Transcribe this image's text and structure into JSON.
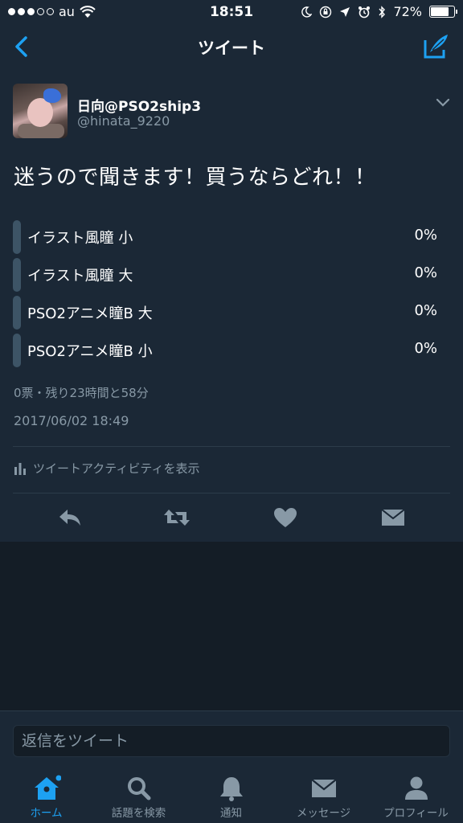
{
  "status_bar": {
    "carrier": "au",
    "time": "18:51",
    "battery": "72%"
  },
  "nav": {
    "title": "ツイート"
  },
  "tweet": {
    "display_name": "日向@PSO2ship3",
    "handle": "@hinata_9220",
    "text": "迷うので聞きます！買うならどれ！！",
    "poll": {
      "options": [
        {
          "label": "イラスト風瞳 小",
          "percent": "0%"
        },
        {
          "label": "イラスト風瞳 大",
          "percent": "0%"
        },
        {
          "label": "PSO2アニメ瞳B 大",
          "percent": "0%"
        },
        {
          "label": "PSO2アニメ瞳B 小",
          "percent": "0%"
        }
      ]
    },
    "meta": "0票・残り23時間と58分",
    "date": "2017/06/02 18:49",
    "activity_label": "ツイートアクティビティを表示"
  },
  "reply": {
    "placeholder": "返信をツイート"
  },
  "tabs": [
    {
      "label": "ホーム",
      "icon": "home-icon"
    },
    {
      "label": "話題を検索",
      "icon": "search-icon"
    },
    {
      "label": "通知",
      "icon": "bell-icon"
    },
    {
      "label": "メッセージ",
      "icon": "envelope-icon"
    },
    {
      "label": "プロフィール",
      "icon": "person-icon"
    }
  ],
  "colors": {
    "accent": "#1da1f2",
    "background": "#141d26",
    "panel": "#1b2836",
    "muted": "#8899a6"
  }
}
